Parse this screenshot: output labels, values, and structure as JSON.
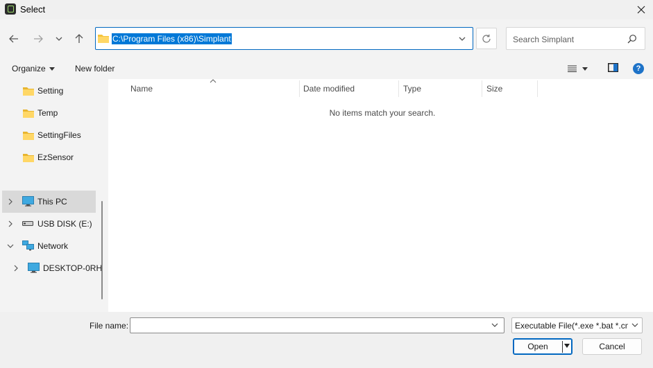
{
  "window": {
    "title": "Select"
  },
  "address": {
    "path": "C:\\Program Files (x86)\\Simplant"
  },
  "search": {
    "placeholder": "Search Simplant"
  },
  "toolbar": {
    "organize_label": "Organize",
    "new_folder_label": "New folder"
  },
  "nav": {
    "items": [
      {
        "label": "Setting",
        "icon": "folder-icon"
      },
      {
        "label": "Temp",
        "icon": "folder-icon"
      },
      {
        "label": "SettingFiles",
        "icon": "folder-icon"
      },
      {
        "label": "EzSensor",
        "icon": "folder-icon"
      },
      {
        "label": "This PC",
        "icon": "monitor-icon",
        "selected": true
      },
      {
        "label": "USB DISK (E:)",
        "icon": "drive-icon"
      },
      {
        "label": "Network",
        "icon": "network-icon",
        "expanded": true
      },
      {
        "label": "DESKTOP-0RH",
        "icon": "monitor-icon"
      }
    ]
  },
  "filelist": {
    "columns": [
      "Name",
      "Date modified",
      "Type",
      "Size"
    ],
    "empty_message": "No items match your search."
  },
  "bottom": {
    "filename_label": "File name:",
    "filename_value": "",
    "filetype_value": "Executable File(*.exe *.bat *.cmd)",
    "open_label": "Open",
    "cancel_label": "Cancel"
  },
  "colors": {
    "accent": "#0067c0",
    "selection": "#0078d7",
    "folder": "#f5c43b"
  }
}
